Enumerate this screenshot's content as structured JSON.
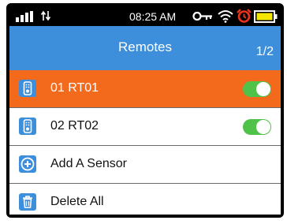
{
  "status_bar": {
    "time": "08:25 AM",
    "icons": [
      "signal-icon",
      "data-transfer-icon",
      "key-icon",
      "wifi-icon",
      "alarm-icon",
      "battery-icon"
    ]
  },
  "header": {
    "title": "Remotes",
    "page_indicator": "1/2"
  },
  "remotes": [
    {
      "label": "01 RT01",
      "icon": "remote-icon",
      "enabled": true,
      "selected": true
    },
    {
      "label": "02 RT02",
      "icon": "remote-icon",
      "enabled": true,
      "selected": false
    }
  ],
  "actions": [
    {
      "label": "Add A Sensor",
      "icon": "add-circle-icon"
    },
    {
      "label": "Delete All",
      "icon": "trash-icon"
    }
  ],
  "colors": {
    "header": "#3d8fdc",
    "selected_row": "#f36a1d",
    "toggle_on": "#50c24a",
    "icon_blue": "#3d8fdc",
    "battery": "#f3e600",
    "alarm": "#e8341c"
  }
}
